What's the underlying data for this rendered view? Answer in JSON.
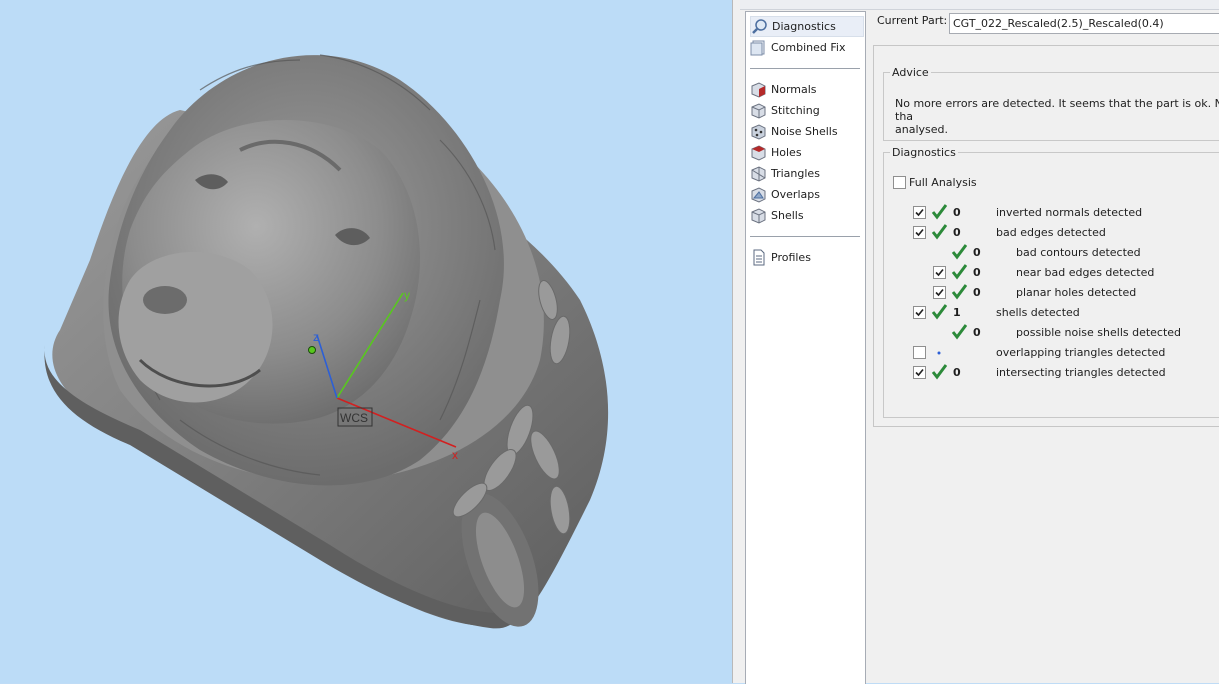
{
  "viewport": {
    "axis_labels": {
      "x": "x",
      "y": "y",
      "z": "z"
    },
    "wcs_label": "WCS",
    "colors": {
      "background": "#bcdcf7",
      "model": "#8a8a8a",
      "x_axis": "#d22020",
      "y_axis": "#58c81e",
      "z_axis": "#2c5fd6"
    }
  },
  "nav": {
    "items": [
      {
        "label": "Diagnostics",
        "icon": "magnifier-icon",
        "selected": true
      },
      {
        "label": "Combined Fix",
        "icon": "combined-fix-icon",
        "selected": false
      },
      {
        "label": "Normals",
        "icon": "normals-cube-icon",
        "selected": false
      },
      {
        "label": "Stitching",
        "icon": "stitching-cube-icon",
        "selected": false
      },
      {
        "label": "Noise Shells",
        "icon": "noise-shells-icon",
        "selected": false
      },
      {
        "label": "Holes",
        "icon": "holes-cube-icon",
        "selected": false
      },
      {
        "label": "Triangles",
        "icon": "triangles-cube-icon",
        "selected": false
      },
      {
        "label": "Overlaps",
        "icon": "overlaps-cube-icon",
        "selected": false
      },
      {
        "label": "Shells",
        "icon": "shells-cube-icon",
        "selected": false
      },
      {
        "label": "Profiles",
        "icon": "document-icon",
        "selected": false
      }
    ]
  },
  "current_part": {
    "label": "Current Part:",
    "value": "CGT_022_Rescaled(2.5)_Rescaled(0.4)"
  },
  "advice": {
    "legend": "Advice",
    "text_line1": "No more errors are detected. It seems that the part is ok. Note tha",
    "text_line2": "analysed."
  },
  "diagnostics": {
    "legend": "Diagnostics",
    "full_analysis_label": "Full Analysis",
    "full_analysis_checked": false,
    "rows": [
      {
        "checkbox": true,
        "checked": true,
        "status": "ok",
        "count": "0",
        "label": "inverted normals detected",
        "indent": 0
      },
      {
        "checkbox": true,
        "checked": true,
        "status": "ok",
        "count": "0",
        "label": "bad edges detected",
        "indent": 0
      },
      {
        "checkbox": false,
        "checked": false,
        "status": "ok",
        "count": "0",
        "label": "bad contours detected",
        "indent": 1
      },
      {
        "checkbox": true,
        "checked": true,
        "status": "ok",
        "count": "0",
        "label": "near bad edges detected",
        "indent": 1
      },
      {
        "checkbox": true,
        "checked": true,
        "status": "ok",
        "count": "0",
        "label": "planar holes detected",
        "indent": 1
      },
      {
        "checkbox": true,
        "checked": true,
        "status": "ok",
        "count": "1",
        "label": "shells detected",
        "indent": 0
      },
      {
        "checkbox": false,
        "checked": false,
        "status": "ok",
        "count": "0",
        "label": "possible noise shells detected",
        "indent": 1
      },
      {
        "checkbox": true,
        "checked": false,
        "status": "none",
        "count": "",
        "label": "overlapping triangles detected",
        "indent": 0
      },
      {
        "checkbox": true,
        "checked": true,
        "status": "ok",
        "count": "0",
        "label": "intersecting triangles detected",
        "indent": 0
      }
    ]
  }
}
